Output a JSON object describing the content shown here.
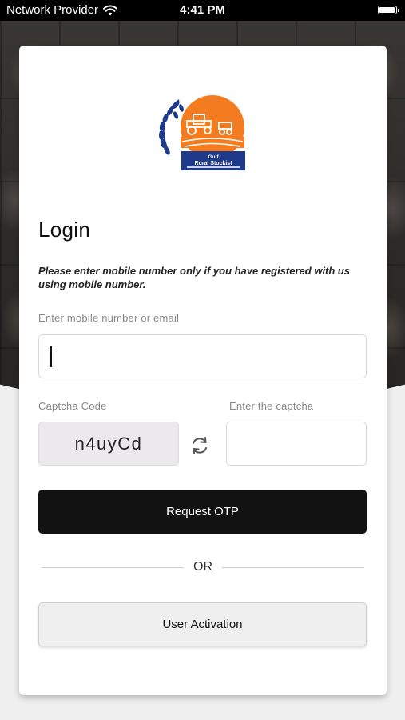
{
  "status_bar": {
    "carrier": "Network Provider",
    "time": "4:41 PM",
    "wifi_icon": "wifi-icon",
    "battery_icon": "battery-icon"
  },
  "logo": {
    "icon": "tractor-farm-logo",
    "colors": {
      "sun": "#f47c20",
      "wheat": "#1f3a8a",
      "banner": "#1f3a8a"
    }
  },
  "login": {
    "title": "Login",
    "note": "Please enter mobile number only if you have registered with us using mobile number.",
    "mobile_label": "Enter mobile number or email",
    "mobile_value": "",
    "captcha_label": "Captcha Code",
    "captcha_code": "n4uyCd",
    "captcha_input_label": "Enter the captcha",
    "captcha_input_value": "",
    "refresh_icon": "refresh-icon",
    "request_otp_label": "Request OTP",
    "or_text": "OR",
    "user_activation_label": "User Activation"
  },
  "colors": {
    "primary_button": "#121212",
    "secondary_button": "#efefef",
    "captcha_bg": "#ebe9eb",
    "label": "#888888"
  }
}
